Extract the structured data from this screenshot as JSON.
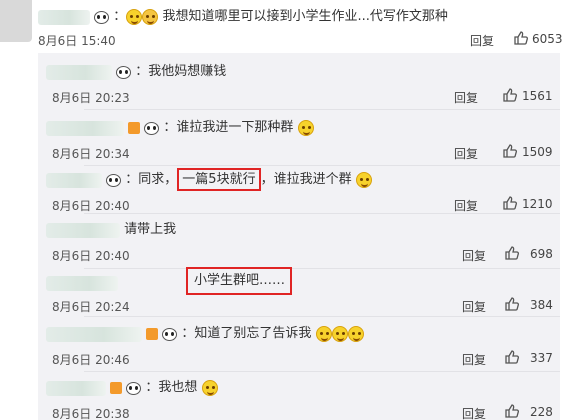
{
  "main_comment": {
    "text": "我想知道哪里可以接到小学生作业...代写作文那种",
    "date": "8月6日 15:40",
    "reply": "回复",
    "likes": "6053"
  },
  "replies": [
    {
      "text": "：我他妈想赚钱",
      "date": "8月6日 20:23",
      "reply": "回复",
      "likes": "1561"
    },
    {
      "text": "：谁拉我进一下那种群",
      "date": "8月6日 20:34",
      "reply": "回复",
      "likes": "1509"
    },
    {
      "pre": "：同求，",
      "highlight": "一篇5块就行",
      "post": "，谁拉我进个群",
      "date": "8月6日 20:40",
      "reply": "回复",
      "likes": "1210"
    },
    {
      "text": "请带上我",
      "date": "8月6日 20:40",
      "reply": "回复",
      "likes": "698"
    },
    {
      "highlight": "小学生群吧……",
      "date": "8月6日 20:24",
      "reply": "回复",
      "likes": "384"
    },
    {
      "text": "：知道了别忘了告诉我",
      "date": "8月6日 20:46",
      "reply": "回复",
      "likes": "337"
    },
    {
      "text": "：我也想",
      "date": "8月6日 20:38",
      "reply": "回复",
      "likes": "228"
    }
  ],
  "accent": {
    "highlight_border": "#e02424",
    "panel_bg": "#f2f2f5"
  }
}
